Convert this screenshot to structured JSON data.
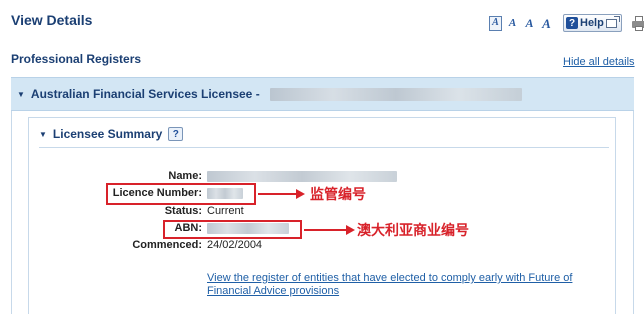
{
  "page": {
    "title": "View Details",
    "section_heading": "Professional Registers",
    "hide_all_label": "Hide all details"
  },
  "toolbar": {
    "font_size_buttons": [
      "A",
      "A",
      "A",
      "A"
    ],
    "help_label": "Help"
  },
  "licensee": {
    "title": "Australian Financial Services Licensee -"
  },
  "summary": {
    "title": "Licensee Summary",
    "help_icon_glyph": "?",
    "fields": {
      "name_label": "Name:",
      "licence_number_label": "Licence Number:",
      "status_label": "Status:",
      "status_value": "Current",
      "abn_label": "ABN:",
      "commenced_label": "Commenced:",
      "commenced_value": "24/02/2004"
    },
    "link_text": "View the register of entities that have elected to comply early with Future of Financial Advice provisions"
  },
  "annotations": {
    "licence_number": "监管编号",
    "abn": "澳大利亚商业编号",
    "color": "#d8222a"
  },
  "colors": {
    "heading": "#1b3f73",
    "link": "#1f5fa6",
    "bar_background": "#d3e6f4"
  },
  "icons": [
    "font-size-icon",
    "help-icon",
    "popout-icon",
    "print-icon",
    "chevron-down-icon",
    "info-icon"
  ]
}
